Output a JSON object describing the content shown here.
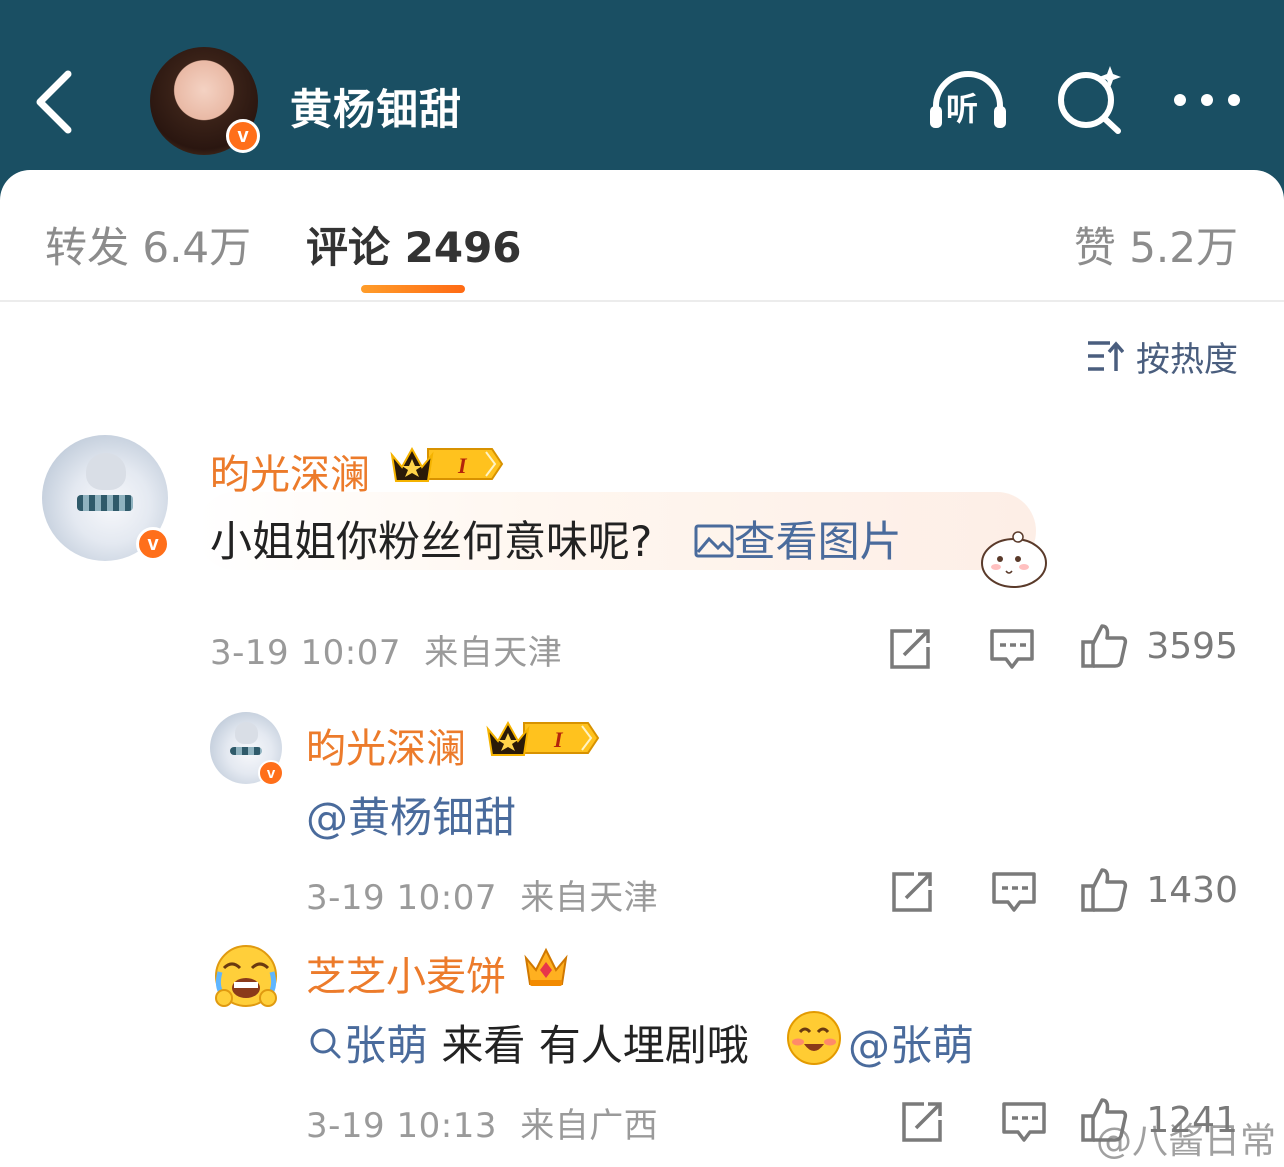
{
  "header": {
    "title": "黄杨钿甜",
    "listen_label": "听"
  },
  "tabs": {
    "repost": "转发 6.4万",
    "comment": "评论 2496",
    "like": "赞 5.2万"
  },
  "sort": {
    "label": "按热度"
  },
  "comments": [
    {
      "user": "昀光深澜",
      "badge": "I",
      "content_text": "小姐姐你粉丝何意味呢?",
      "content_link": "查看图片",
      "time": "3-19 10:07",
      "location": "来自天津",
      "likes": "3595"
    }
  ],
  "replies": [
    {
      "user": "昀光深澜",
      "badge": "I",
      "content_mention": "@黄杨钿甜",
      "time": "3-19 10:07",
      "location": "来自天津",
      "likes": "1430"
    },
    {
      "user": "芝芝小麦饼",
      "content_search": "张萌",
      "content_text": "来看 有人埋剧哦",
      "content_mention": "@张萌",
      "time": "3-19 10:13",
      "location": "来自广西",
      "likes": "1241"
    }
  ],
  "watermark": "@八酱日常",
  "colors": {
    "header_bg": "#1a4f63",
    "username": "#ec7b2b",
    "link": "#4a6b9c",
    "accent": "#ff6a14"
  }
}
